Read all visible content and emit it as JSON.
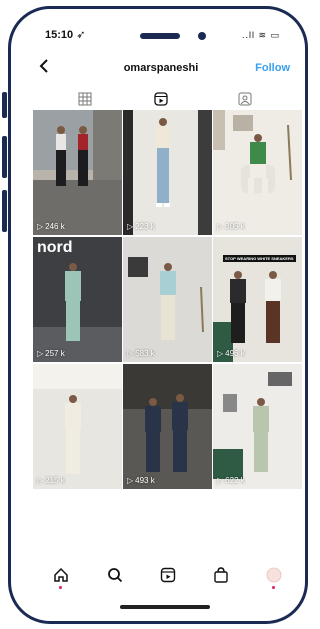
{
  "status_bar": {
    "time": "15:10 ➶",
    "icons": "..ll ≋ ▭"
  },
  "header": {
    "back_icon": "chevron-left-icon",
    "username": "omarspaneshi",
    "follow_label": "Follow"
  },
  "tabs": [
    {
      "icon": "grid-icon",
      "active": false
    },
    {
      "icon": "reels-icon",
      "active": true
    },
    {
      "icon": "tagged-icon",
      "active": false
    }
  ],
  "reels": [
    {
      "views": "246 k"
    },
    {
      "views": "223 k"
    },
    {
      "views": "305 k"
    },
    {
      "views": "257 k",
      "overlay_text": "nord"
    },
    {
      "views": "583 k"
    },
    {
      "views": "496 k",
      "overlay_text": "STOP WEARING WHITE SNEAKERS"
    },
    {
      "views": "215 k"
    },
    {
      "views": "493 k"
    },
    {
      "views": "622 k"
    }
  ],
  "bottom_nav": [
    {
      "icon": "home-icon"
    },
    {
      "icon": "search-icon"
    },
    {
      "icon": "reels-icon"
    },
    {
      "icon": "shop-icon"
    },
    {
      "icon": "profile-avatar-icon"
    }
  ],
  "colors": {
    "accent": "#3aa0f0",
    "frame": "#1a2a52",
    "notification_dot": "#e0245e"
  }
}
